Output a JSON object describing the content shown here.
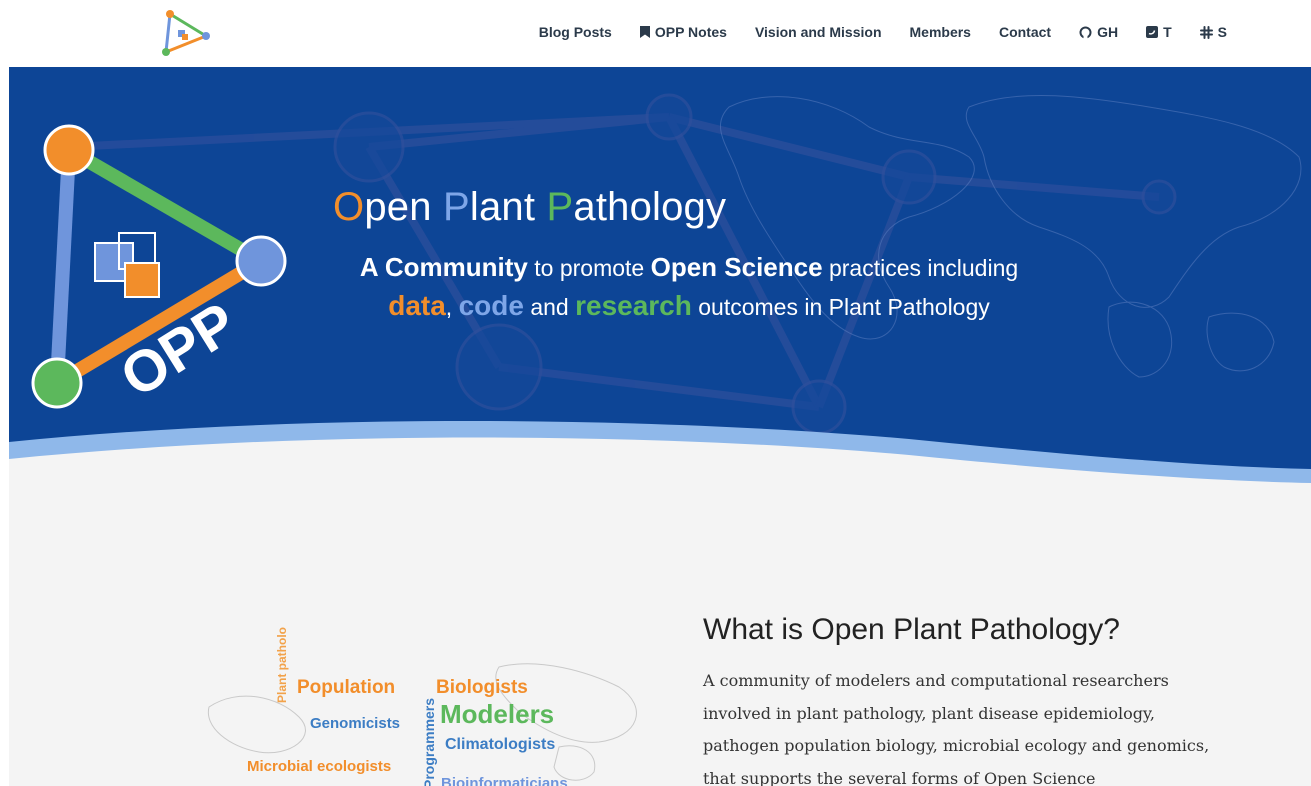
{
  "nav": {
    "items": [
      {
        "label": "Blog Posts",
        "icon": ""
      },
      {
        "label": "OPP Notes",
        "icon": "bookmark-icon"
      },
      {
        "label": "Vision and Mission",
        "icon": ""
      },
      {
        "label": "Members",
        "icon": ""
      },
      {
        "label": "Contact",
        "icon": ""
      },
      {
        "label": "GH",
        "icon": "github-icon"
      },
      {
        "label": "T",
        "icon": "twitter-icon"
      },
      {
        "label": "S",
        "icon": "slack-icon"
      }
    ]
  },
  "hero": {
    "title": {
      "o": "O",
      "pen": "pen ",
      "p1": "P",
      "lant": "lant ",
      "p2": "P",
      "athology": "athology"
    },
    "tagline": {
      "t1": "A Community",
      "t2": " to promote ",
      "t3": "Open Science",
      "t4": " practices including",
      "t5": "data",
      "t6": ", ",
      "t7": "code",
      "t8": " and ",
      "t9": "research",
      "t10": " outcomes in Plant Pathology"
    },
    "logo_text": "OPP",
    "colors": {
      "background": "#0d4596",
      "orange": "#f28e2b",
      "blue": "#7ea6e8",
      "green": "#5cb85c"
    }
  },
  "about": {
    "heading": "What is Open Plant Pathology?",
    "text": "A community of modelers and computational researchers involved in plant pathology, plant disease epidemiology, pathogen population biology, microbial ecology and genomics, that supports the several forms of Open Science"
  },
  "word_cloud": {
    "words": [
      "Plant pathologists",
      "Population",
      "Biologists",
      "Programmers",
      "Modelers",
      "Genomicists",
      "Climatologists",
      "Microbial ecologists",
      "Bioinformaticians"
    ]
  }
}
